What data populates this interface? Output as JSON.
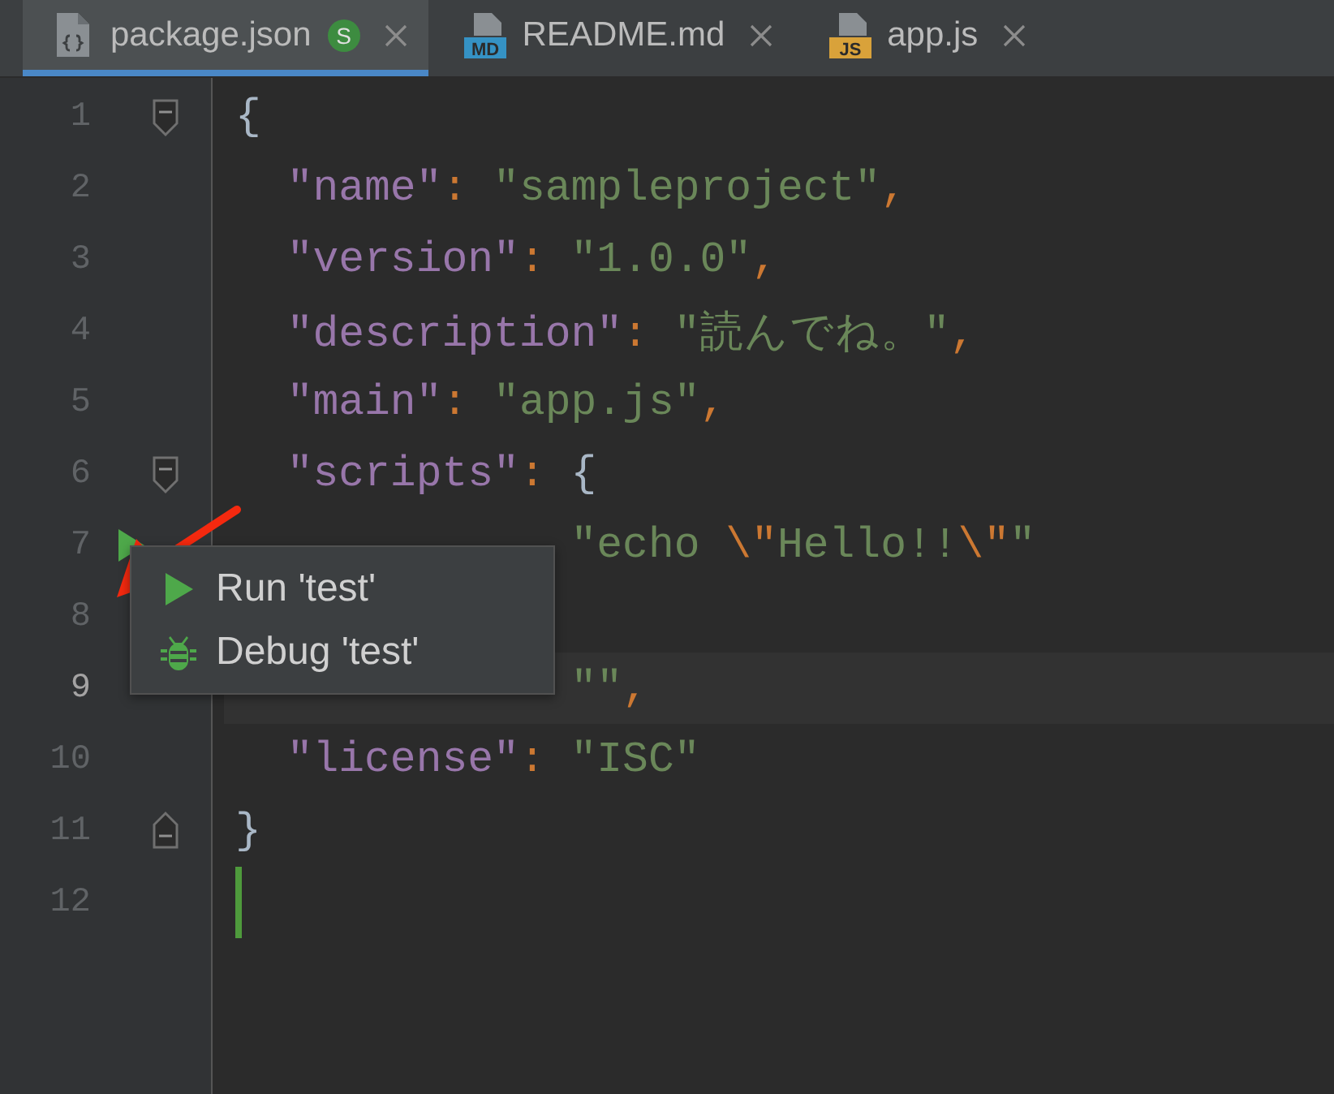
{
  "tabs": [
    {
      "label": "package.json",
      "kind": "json",
      "badge": "S",
      "selected": true
    },
    {
      "label": "README.md",
      "kind": "md",
      "icon_label": "MD",
      "selected": false
    },
    {
      "label": "app.js",
      "kind": "js",
      "icon_label": "JS",
      "selected": false
    }
  ],
  "editor": {
    "lines": [
      {
        "number": "1",
        "fold_start": true,
        "fold_end": false,
        "run_marker": false,
        "current": false,
        "caret": false,
        "tokens": [
          {
            "kind": "brace",
            "text": "{"
          }
        ]
      },
      {
        "number": "2",
        "fold_start": false,
        "fold_end": false,
        "run_marker": false,
        "current": false,
        "caret": false,
        "tokens": [
          {
            "kind": "key",
            "text": "  \"name\""
          },
          {
            "kind": "punct",
            "text": ": "
          },
          {
            "kind": "string",
            "text": "\"sampleproject\""
          },
          {
            "kind": "punct",
            "text": ","
          }
        ]
      },
      {
        "number": "3",
        "fold_start": false,
        "fold_end": false,
        "run_marker": false,
        "current": false,
        "caret": false,
        "tokens": [
          {
            "kind": "key",
            "text": "  \"version\""
          },
          {
            "kind": "punct",
            "text": ": "
          },
          {
            "kind": "string",
            "text": "\"1.0.0\""
          },
          {
            "kind": "punct",
            "text": ","
          }
        ]
      },
      {
        "number": "4",
        "fold_start": false,
        "fold_end": false,
        "run_marker": false,
        "current": false,
        "caret": false,
        "tokens": [
          {
            "kind": "key",
            "text": "  \"description\""
          },
          {
            "kind": "punct",
            "text": ": "
          },
          {
            "kind": "string",
            "text": "\"読んでね。\""
          },
          {
            "kind": "punct",
            "text": ","
          }
        ]
      },
      {
        "number": "5",
        "fold_start": false,
        "fold_end": false,
        "run_marker": false,
        "current": false,
        "caret": false,
        "tokens": [
          {
            "kind": "key",
            "text": "  \"main\""
          },
          {
            "kind": "punct",
            "text": ": "
          },
          {
            "kind": "string",
            "text": "\"app.js\""
          },
          {
            "kind": "punct",
            "text": ","
          }
        ]
      },
      {
        "number": "6",
        "fold_start": true,
        "fold_end": false,
        "run_marker": false,
        "current": false,
        "caret": false,
        "tokens": [
          {
            "kind": "key",
            "text": "  \"scripts\""
          },
          {
            "kind": "punct",
            "text": ": "
          },
          {
            "kind": "brace",
            "text": "{"
          }
        ]
      },
      {
        "number": "7",
        "fold_start": false,
        "fold_end": false,
        "run_marker": true,
        "current": false,
        "caret": false,
        "tokens": [
          {
            "kind": "string",
            "text": "             \"echo "
          },
          {
            "kind": "escape",
            "text": "\\\""
          },
          {
            "kind": "string",
            "text": "Hello!!"
          },
          {
            "kind": "escape",
            "text": "\\\""
          },
          {
            "kind": "string",
            "text": "\""
          }
        ]
      },
      {
        "number": "8",
        "fold_start": false,
        "fold_end": false,
        "run_marker": false,
        "current": false,
        "caret": false
      },
      {
        "number": "9",
        "fold_start": false,
        "fold_end": false,
        "run_marker": false,
        "current": true,
        "caret": false,
        "tokens": [
          {
            "kind": "string",
            "text": "             \"\""
          },
          {
            "kind": "punct",
            "text": ","
          }
        ]
      },
      {
        "number": "10",
        "fold_start": false,
        "fold_end": false,
        "run_marker": false,
        "current": false,
        "caret": false,
        "tokens": [
          {
            "kind": "key",
            "text": "  \"license\""
          },
          {
            "kind": "punct",
            "text": ": "
          },
          {
            "kind": "string",
            "text": "\"ISC\""
          }
        ]
      },
      {
        "number": "11",
        "fold_start": false,
        "fold_end": true,
        "run_marker": false,
        "current": false,
        "caret": false,
        "tokens": [
          {
            "kind": "brace",
            "text": "}"
          }
        ]
      },
      {
        "number": "12",
        "fold_start": false,
        "fold_end": false,
        "run_marker": false,
        "current": false,
        "caret": true
      }
    ]
  },
  "popup": {
    "items": [
      {
        "kind": "run",
        "label": "Run 'test'"
      },
      {
        "kind": "debug",
        "label": "Debug 'test'"
      }
    ]
  }
}
